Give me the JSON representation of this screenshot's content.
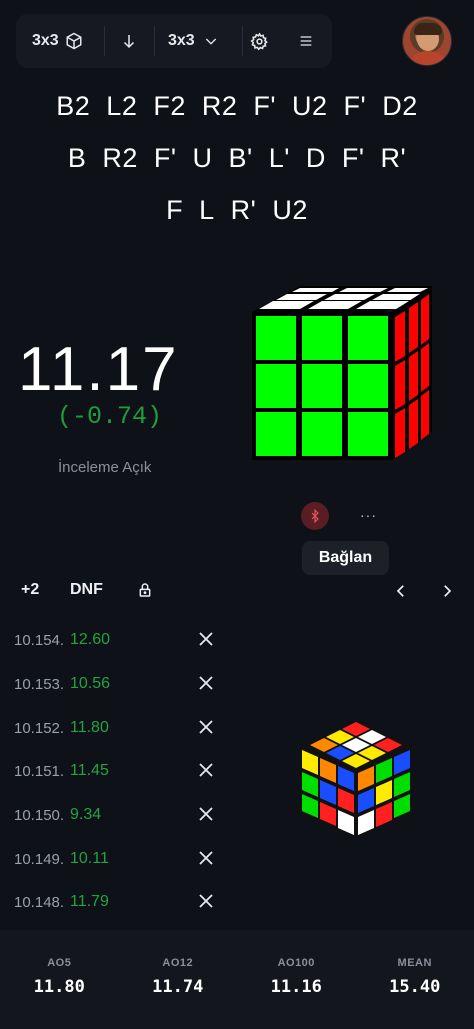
{
  "toolbar": {
    "puzzle_label": "3x3",
    "session_label": "3x3"
  },
  "scramble": [
    [
      "B2",
      "L2",
      "F2",
      "R2",
      "F'",
      "U2",
      "F'",
      "D2"
    ],
    [
      "B",
      "R2",
      "F'",
      "U",
      "B'",
      "L'",
      "D",
      "F'",
      "R'"
    ],
    [
      "F",
      "L",
      "R'",
      "U2"
    ]
  ],
  "timer": {
    "time": "11.17",
    "delta": "(-0.74)",
    "review_label": "İnceleme Açık"
  },
  "device": {
    "more_label": "···",
    "connect_label": "Bağlan"
  },
  "penalties": {
    "plus2_label": "+2",
    "dnf_label": "DNF"
  },
  "solves": [
    {
      "index": "10.154.",
      "time": "12.60"
    },
    {
      "index": "10.153.",
      "time": "10.56"
    },
    {
      "index": "10.152.",
      "time": "11.80"
    },
    {
      "index": "10.151.",
      "time": "11.45"
    },
    {
      "index": "10.150.",
      "time": "9.34"
    },
    {
      "index": "10.149.",
      "time": "10.11"
    },
    {
      "index": "10.148.",
      "time": "11.79"
    }
  ],
  "stats": [
    {
      "label": "AO5",
      "value": "11.80"
    },
    {
      "label": "AO12",
      "value": "11.74"
    },
    {
      "label": "AO100",
      "value": "11.16"
    },
    {
      "label": "MEAN",
      "value": "15.40"
    }
  ],
  "colors": {
    "background": "#0f1118",
    "positive_time": "#22a43f",
    "cube_green": "#00ff00",
    "cube_red": "#ff0000",
    "cube_white": "#ffffff"
  },
  "icons": [
    "cube-icon",
    "arrow-down-icon",
    "chevron-down-icon",
    "gear-icon",
    "menu-icon",
    "bluetooth-icon",
    "lock-icon",
    "chevron-left-icon",
    "chevron-right-icon",
    "close-icon"
  ]
}
